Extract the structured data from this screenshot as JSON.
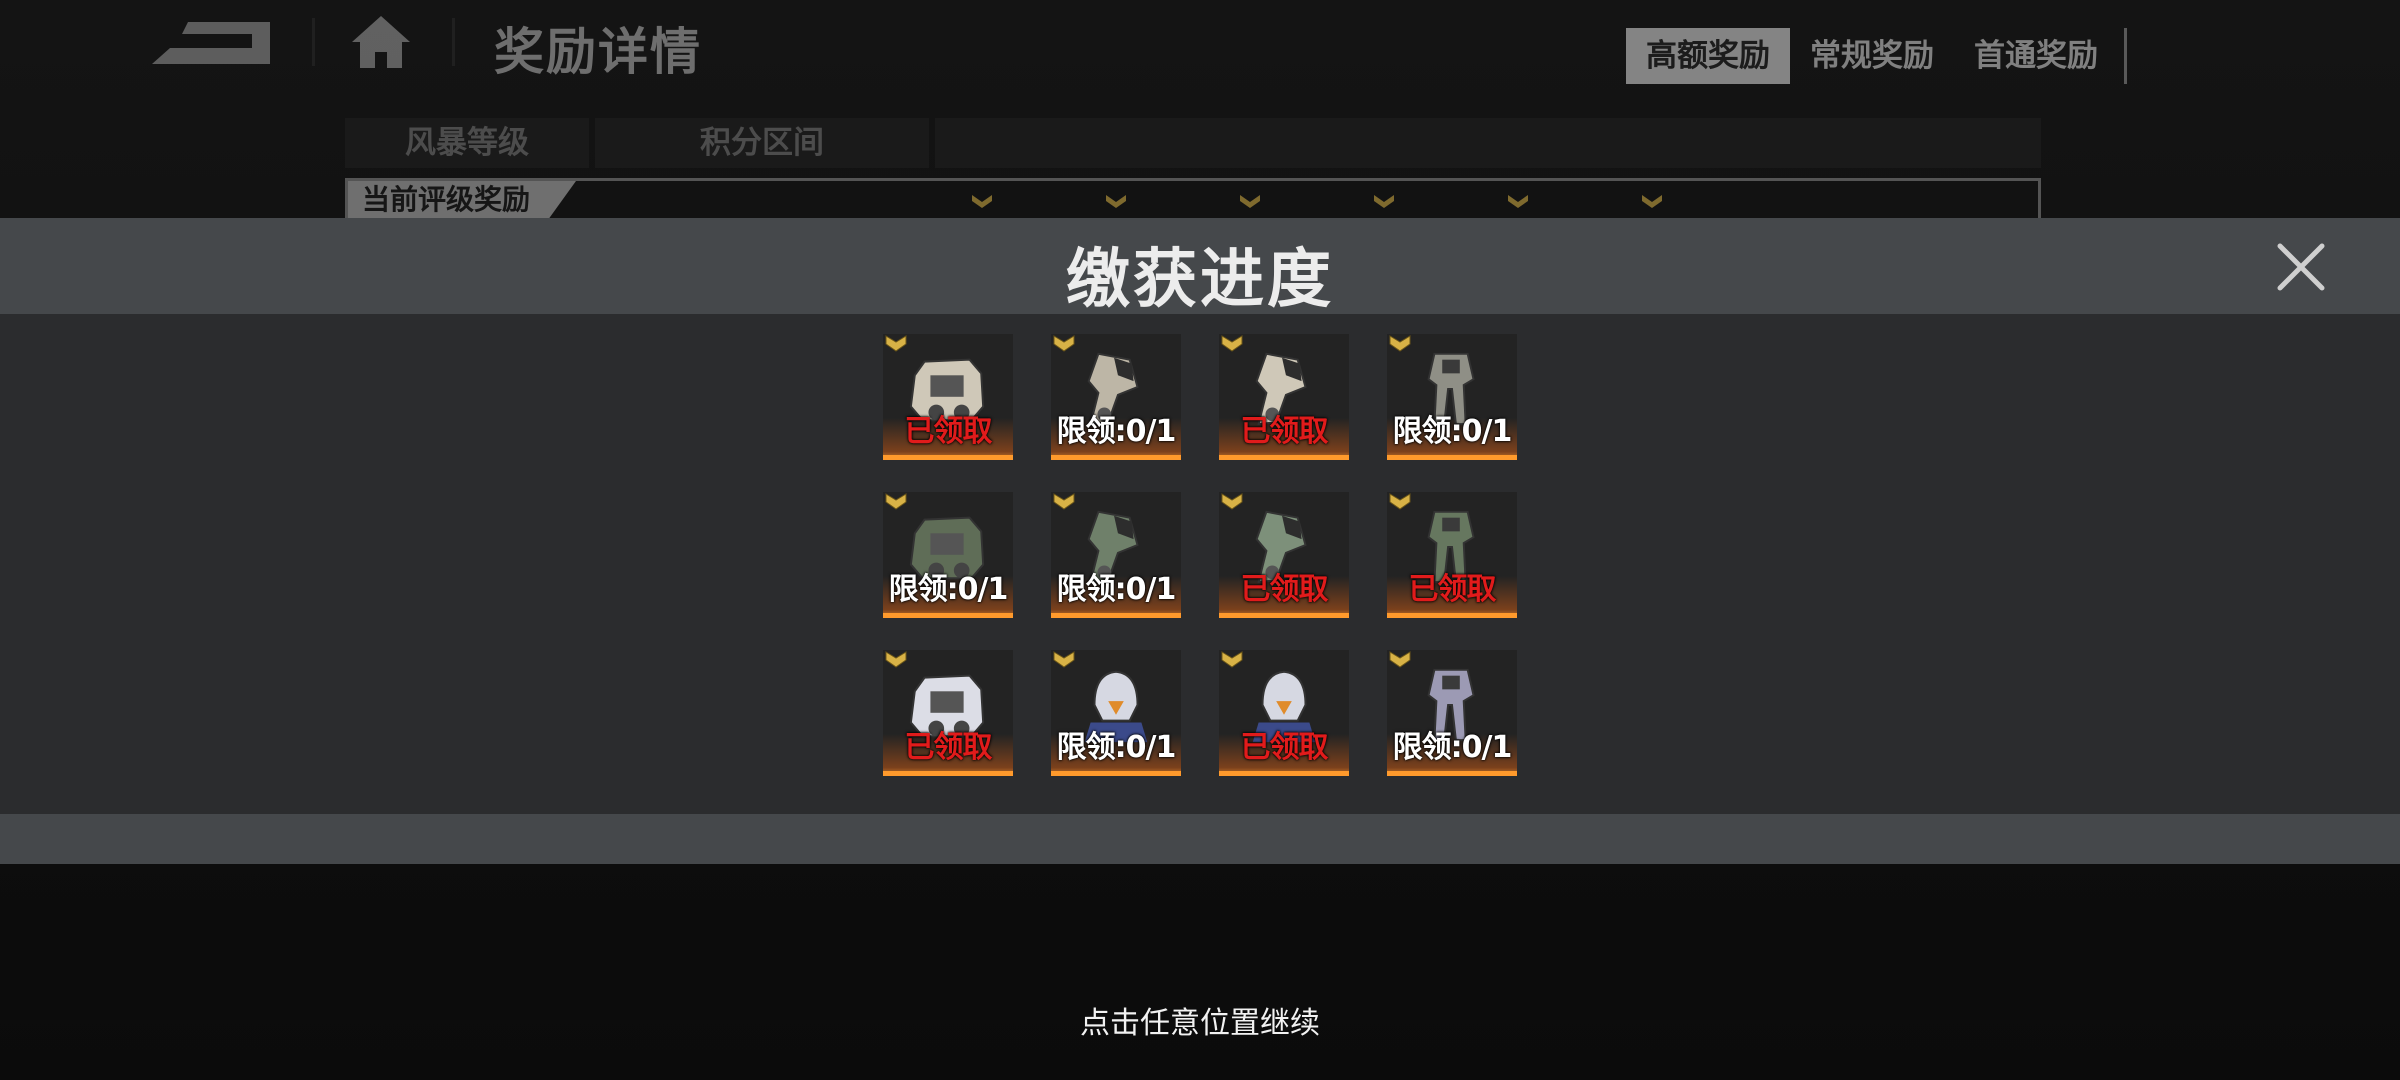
{
  "background": {
    "page_title": "奖励详情",
    "tabs": [
      {
        "label": "高额奖励",
        "active": true
      },
      {
        "label": "常规奖励",
        "active": false
      },
      {
        "label": "首通奖励",
        "active": false
      }
    ],
    "columns": [
      "风暴等级",
      "积分区间"
    ],
    "rating_label": "当前评级奖励"
  },
  "modal": {
    "title": "缴获进度",
    "items": [
      {
        "status": "已领取",
        "claimed": true,
        "icon": "mech-armor-white-icon",
        "color": "#cfc8b8"
      },
      {
        "status": "限领:0/1",
        "claimed": false,
        "icon": "mech-arm-white-icon",
        "color": "#bdb6a6"
      },
      {
        "status": "已领取",
        "claimed": true,
        "icon": "mech-arm-white-icon",
        "color": "#cfc8b8"
      },
      {
        "status": "限领:0/1",
        "claimed": false,
        "icon": "mech-legs-dark-icon",
        "color": "#8f8f86"
      },
      {
        "status": "限领:0/1",
        "claimed": false,
        "icon": "mech-armor-green-icon",
        "color": "#5f6d57"
      },
      {
        "status": "限领:0/1",
        "claimed": false,
        "icon": "mech-arm-green-icon",
        "color": "#6f806a"
      },
      {
        "status": "已领取",
        "claimed": true,
        "icon": "mech-arm-green-icon",
        "color": "#7d907a"
      },
      {
        "status": "已领取",
        "claimed": true,
        "icon": "mech-legs-green-icon",
        "color": "#66775f"
      },
      {
        "status": "已领取",
        "claimed": true,
        "icon": "mech-armor-blue-icon",
        "color": "#dcdde6"
      },
      {
        "status": "限领:0/1",
        "claimed": false,
        "icon": "mech-head-blue-icon",
        "color": "#d6d8e2"
      },
      {
        "status": "已领取",
        "claimed": true,
        "icon": "mech-head-blue-icon",
        "color": "#d6d8e2"
      },
      {
        "status": "限领:0/1",
        "claimed": false,
        "icon": "mech-legs-purple-icon",
        "color": "#9c9ab4"
      }
    ]
  },
  "hint": "点击任意位置继续",
  "colors": {
    "accent_orange": "#ff9a2c",
    "claimed_red": "#e11b1b",
    "badge_gold": "#d8b246"
  }
}
